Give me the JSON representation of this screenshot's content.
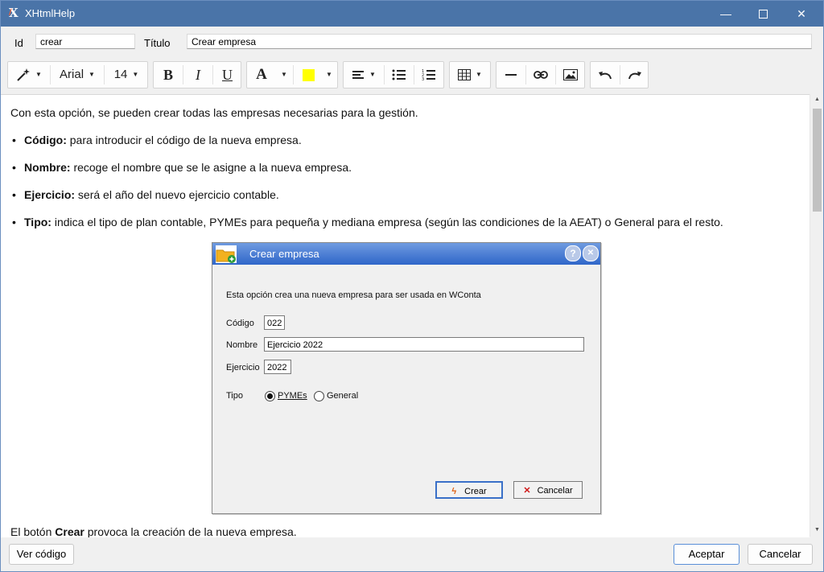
{
  "window": {
    "title": "XHtmlHelp",
    "icon": "app-x-icon"
  },
  "fields": {
    "id_label": "Id",
    "id_value": "crear",
    "title_label": "Título",
    "title_value": "Crear empresa"
  },
  "toolbar": {
    "font": "Arial",
    "size": "14",
    "bold": "B",
    "italic": "I",
    "underline": "U",
    "font_color_glyph": "A",
    "highlight_color": "#ffff00",
    "icons": [
      "magic-wand-icon",
      "align-left-icon",
      "bullet-list-icon",
      "numbered-list-icon",
      "table-icon",
      "horizontal-rule-icon",
      "link-icon",
      "image-icon",
      "undo-icon",
      "redo-icon"
    ]
  },
  "content": {
    "intro": "Con esta opción, se pueden crear todas las empresas necesarias para la gestión.",
    "bullets": [
      {
        "term": "Código:",
        "text": " para introducir el código de la nueva empresa."
      },
      {
        "term": "Nombre:",
        "text": " recoge el nombre que se le asigne a la nueva empresa."
      },
      {
        "term": "Ejercicio:",
        "text": " será el año del nuevo ejercicio contable."
      },
      {
        "term": "Tipo:",
        "text": " indica el tipo de plan contable, PYMEs para pequeña y mediana empresa (según las condiciones de la AEAT) o General para el resto."
      }
    ],
    "outro_prefix": "El botón ",
    "outro_bold": "Crear",
    "outro_suffix": " provoca la creación de la nueva empresa."
  },
  "dialog": {
    "title": "Crear empresa",
    "help": "?",
    "close": "✕",
    "description": "Esta opción crea una nueva empresa para ser usada en WConta",
    "codigo_label": "Código",
    "codigo_value": "022",
    "nombre_label": "Nombre",
    "nombre_value": "Ejercicio 2022",
    "ejercicio_label": "Ejercicio",
    "ejercicio_value": "2022",
    "tipo_label": "Tipo",
    "opt_pymes": "PYMEs",
    "opt_general": "General",
    "crear_btn": "Crear",
    "cancelar_btn": "Cancelar"
  },
  "footer": {
    "ver_codigo": "Ver código",
    "aceptar": "Aceptar",
    "cancelar": "Cancelar"
  }
}
